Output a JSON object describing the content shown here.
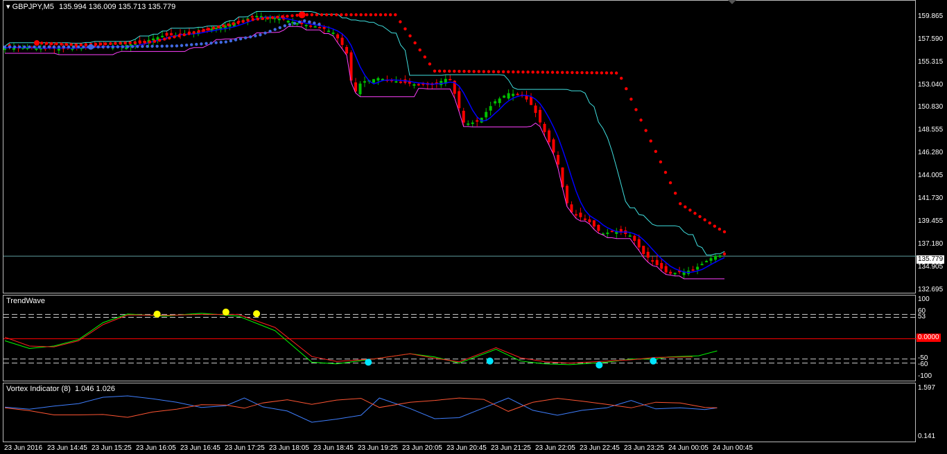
{
  "symbol": "GBPJPY,M5",
  "ohlc": "135.994 136.009 135.713 135.779",
  "main_price_levels": [
    "159.865",
    "157.590",
    "155.315",
    "153.040",
    "150.830",
    "148.555",
    "146.280",
    "144.005",
    "141.730",
    "139.455",
    "137.180",
    "134.905",
    "132.695"
  ],
  "main_price_range": [
    132.0,
    161.2
  ],
  "current_price": "135.779",
  "current_price_value": 135.779,
  "trendwave": {
    "name": "TrendWave",
    "levels": [
      "100",
      "60",
      "53",
      "0.0000",
      "-50",
      "-60",
      "-100"
    ],
    "zero_label": "0.0000"
  },
  "vortex": {
    "name": "Vortex Indicator (8)",
    "values": "1.046 1.026",
    "levels": [
      "1.597",
      "0.141"
    ]
  },
  "time_labels": [
    "23 Jun 2016",
    "23 Jun 14:45",
    "23 Jun 15:25",
    "23 Jun 16:05",
    "23 Jun 16:45",
    "23 Jun 17:25",
    "23 Jun 18:05",
    "23 Jun 18:45",
    "23 Jun 19:25",
    "23 Jun 20:05",
    "23 Jun 20:45",
    "23 Jun 21:25",
    "23 Jun 22:05",
    "23 Jun 22:45",
    "23 Jun 23:25",
    "24 Jun 00:05",
    "24 Jun 00:45"
  ],
  "colors": {
    "bull": "#00c000",
    "bear": "#ff0000",
    "blue_dots": "#4169e1",
    "red_dots": "#ff0000",
    "upper_channel": "#40e0e0",
    "lower_channel": "#ff40ff",
    "current_price_line": "#5f9ea0",
    "zero_line": "#ff0000"
  },
  "chart_data": {
    "type": "line",
    "candle_anchors": [
      [
        0,
        156.6
      ],
      [
        24,
        156.5
      ],
      [
        48,
        156.4
      ],
      [
        72,
        156.6
      ],
      [
        96,
        156.7
      ],
      [
        112,
        157.1
      ],
      [
        128,
        157.7
      ],
      [
        144,
        157.8
      ],
      [
        160,
        158.2
      ],
      [
        176,
        158.6
      ],
      [
        192,
        159.2
      ],
      [
        204,
        159.7
      ],
      [
        216,
        159.6
      ],
      [
        228,
        159.3
      ],
      [
        240,
        158.9
      ],
      [
        256,
        158.6
      ],
      [
        268,
        158.0
      ],
      [
        278,
        156.2
      ],
      [
        284,
        151.8
      ],
      [
        290,
        153.1
      ],
      [
        304,
        153.5
      ],
      [
        318,
        153.2
      ],
      [
        332,
        152.9
      ],
      [
        348,
        152.8
      ],
      [
        362,
        153.6
      ],
      [
        374,
        148.9
      ],
      [
        386,
        149.2
      ],
      [
        398,
        151.1
      ],
      [
        410,
        152.0
      ],
      [
        422,
        151.8
      ],
      [
        430,
        150.6
      ],
      [
        440,
        148.0
      ],
      [
        450,
        145.2
      ],
      [
        456,
        141.5
      ],
      [
        462,
        140.0
      ],
      [
        474,
        139.4
      ],
      [
        486,
        138.0
      ],
      [
        498,
        138.3
      ],
      [
        510,
        137.8
      ],
      [
        520,
        136.0
      ],
      [
        530,
        135.0
      ],
      [
        540,
        134.0
      ],
      [
        550,
        134.2
      ],
      [
        560,
        134.4
      ],
      [
        570,
        135.2
      ],
      [
        578,
        135.8
      ],
      [
        586,
        135.9
      ]
    ],
    "blue_dots": [
      [
        0,
        156.6
      ],
      [
        86,
        156.6
      ],
      [
        140,
        156.7
      ],
      [
        180,
        157.1
      ],
      [
        208,
        157.8
      ],
      [
        228,
        158.7
      ],
      [
        244,
        159.2
      ],
      [
        258,
        158.8
      ]
    ],
    "red_dots": [
      [
        26,
        157.0
      ],
      [
        60,
        156.8
      ],
      [
        120,
        157.1
      ],
      [
        200,
        159.3
      ],
      [
        242,
        159.8
      ],
      [
        318,
        159.8
      ],
      [
        350,
        154.2
      ],
      [
        500,
        154.0
      ],
      [
        550,
        141.0
      ],
      [
        580,
        138.6
      ],
      [
        586,
        138.2
      ]
    ],
    "trendwave_green": [
      [
        0,
        -5
      ],
      [
        20,
        -24
      ],
      [
        40,
        -18
      ],
      [
        60,
        -2
      ],
      [
        80,
        40
      ],
      [
        100,
        61
      ],
      [
        130,
        56
      ],
      [
        160,
        63
      ],
      [
        190,
        56
      ],
      [
        220,
        20
      ],
      [
        250,
        -58
      ],
      [
        270,
        -62
      ],
      [
        300,
        -50
      ],
      [
        330,
        -37
      ],
      [
        350,
        -45
      ],
      [
        370,
        -60
      ],
      [
        400,
        -26
      ],
      [
        420,
        -55
      ],
      [
        440,
        -62
      ],
      [
        460,
        -64
      ],
      [
        490,
        -58
      ],
      [
        510,
        -50
      ],
      [
        530,
        -50
      ],
      [
        540,
        -45
      ],
      [
        565,
        -42
      ],
      [
        580,
        -30
      ]
    ],
    "trendwave_red": [
      [
        0,
        4
      ],
      [
        20,
        -18
      ],
      [
        40,
        -20
      ],
      [
        60,
        -5
      ],
      [
        80,
        35
      ],
      [
        100,
        59
      ],
      [
        130,
        58
      ],
      [
        160,
        60
      ],
      [
        190,
        60
      ],
      [
        220,
        28
      ],
      [
        250,
        -44
      ],
      [
        270,
        -56
      ],
      [
        300,
        -50
      ],
      [
        330,
        -37
      ],
      [
        350,
        -48
      ],
      [
        370,
        -57
      ],
      [
        400,
        -22
      ],
      [
        420,
        -47
      ],
      [
        440,
        -57
      ],
      [
        460,
        -60
      ],
      [
        490,
        -55
      ],
      [
        510,
        -52
      ],
      [
        530,
        -46
      ],
      [
        560,
        -45
      ]
    ],
    "trendwave_markers": [
      [
        124,
        61
      ],
      [
        180,
        66
      ],
      [
        205,
        62
      ],
      [
        296,
        -58
      ],
      [
        395,
        -55
      ],
      [
        484,
        -65
      ],
      [
        528,
        -55
      ]
    ],
    "vortex_plus": [
      [
        0,
        1.08
      ],
      [
        20,
        1.02
      ],
      [
        40,
        1.11
      ],
      [
        60,
        1.18
      ],
      [
        80,
        1.36
      ],
      [
        100,
        1.4
      ],
      [
        120,
        1.32
      ],
      [
        140,
        1.22
      ],
      [
        160,
        1.07
      ],
      [
        180,
        1.12
      ],
      [
        195,
        1.34
      ],
      [
        210,
        1.09
      ],
      [
        230,
        0.97
      ],
      [
        250,
        0.65
      ],
      [
        270,
        0.74
      ],
      [
        290,
        0.85
      ],
      [
        305,
        1.34
      ],
      [
        330,
        1.04
      ],
      [
        350,
        0.75
      ],
      [
        370,
        0.78
      ],
      [
        390,
        1.06
      ],
      [
        410,
        1.34
      ],
      [
        430,
        0.99
      ],
      [
        450,
        0.85
      ],
      [
        470,
        0.99
      ],
      [
        490,
        1.06
      ],
      [
        510,
        1.27
      ],
      [
        530,
        1.03
      ],
      [
        550,
        1.06
      ],
      [
        570,
        1.01
      ],
      [
        580,
        1.06
      ]
    ],
    "vortex_minus": [
      [
        0,
        1.06
      ],
      [
        20,
        0.98
      ],
      [
        40,
        0.86
      ],
      [
        60,
        0.86
      ],
      [
        80,
        0.87
      ],
      [
        100,
        0.79
      ],
      [
        120,
        0.94
      ],
      [
        140,
        1.02
      ],
      [
        160,
        1.15
      ],
      [
        180,
        1.14
      ],
      [
        195,
        1.05
      ],
      [
        210,
        1.2
      ],
      [
        230,
        1.29
      ],
      [
        250,
        1.16
      ],
      [
        270,
        1.28
      ],
      [
        290,
        1.33
      ],
      [
        305,
        1.07
      ],
      [
        330,
        1.22
      ],
      [
        350,
        1.27
      ],
      [
        370,
        1.34
      ],
      [
        390,
        1.3
      ],
      [
        410,
        0.96
      ],
      [
        430,
        1.22
      ],
      [
        450,
        1.33
      ],
      [
        470,
        1.25
      ],
      [
        490,
        1.16
      ],
      [
        510,
        1.06
      ],
      [
        530,
        1.22
      ],
      [
        550,
        1.2
      ],
      [
        570,
        1.07
      ],
      [
        580,
        1.06
      ]
    ]
  }
}
